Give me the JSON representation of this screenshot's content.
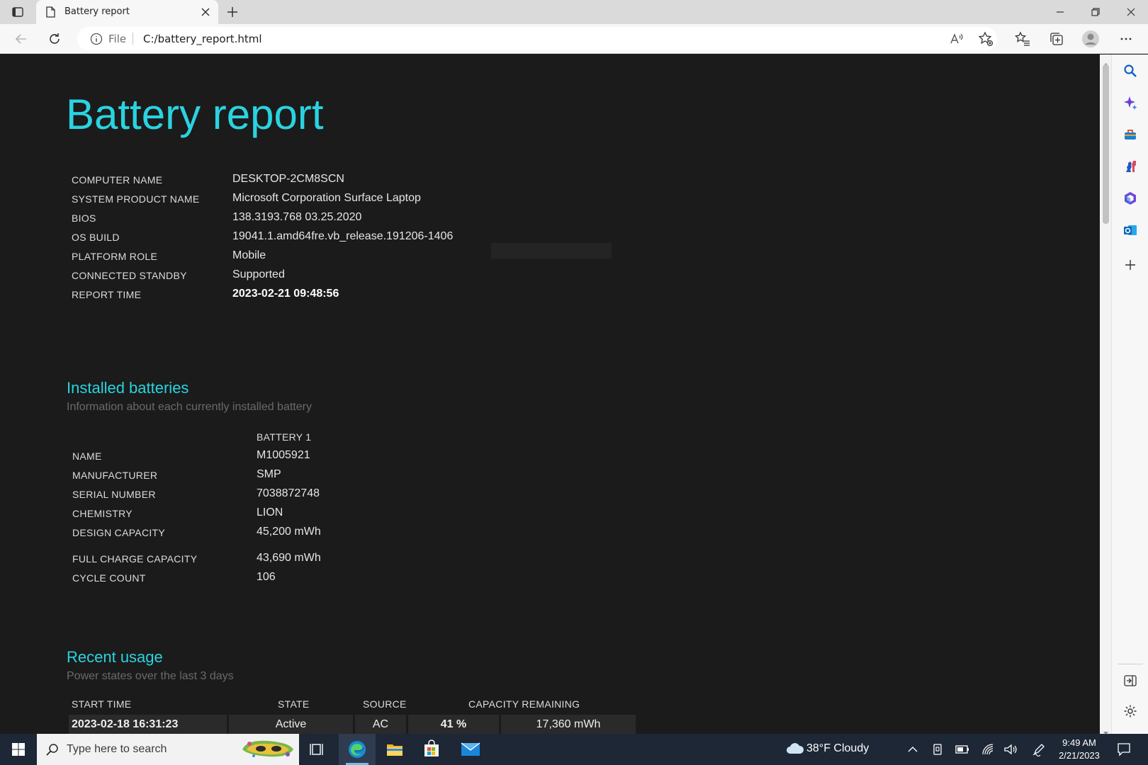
{
  "browser": {
    "tab_title": "Battery report",
    "address_scheme": "File",
    "address_url": "C:/battery_report.html"
  },
  "report": {
    "title": "Battery report",
    "system_info": [
      {
        "label": "COMPUTER NAME",
        "value": "DESKTOP-2CM8SCN"
      },
      {
        "label": "SYSTEM PRODUCT NAME",
        "value": "Microsoft Corporation Surface Laptop"
      },
      {
        "label": "BIOS",
        "value": "138.3193.768 03.25.2020"
      },
      {
        "label": "OS BUILD",
        "value": "19041.1.amd64fre.vb_release.191206-1406"
      },
      {
        "label": "PLATFORM ROLE",
        "value": "Mobile"
      },
      {
        "label": "CONNECTED STANDBY",
        "value": "Supported"
      },
      {
        "label": "REPORT TIME",
        "value": "2023-02-21  09:48:56"
      }
    ],
    "installed_batteries": {
      "heading": "Installed batteries",
      "subheading": "Information about each currently installed battery",
      "column_header": "BATTERY 1",
      "rows": [
        {
          "label": "NAME",
          "value": "M1005921"
        },
        {
          "label": "MANUFACTURER",
          "value": "SMP"
        },
        {
          "label": "SERIAL NUMBER",
          "value": "7038872748"
        },
        {
          "label": "CHEMISTRY",
          "value": "LION"
        },
        {
          "label": "DESIGN CAPACITY",
          "value": "45,200 mWh"
        },
        {
          "label": "FULL CHARGE CAPACITY",
          "value": "43,690 mWh"
        },
        {
          "label": "CYCLE COUNT",
          "value": "106"
        }
      ]
    },
    "recent_usage": {
      "heading": "Recent usage",
      "subheading": "Power states over the last 3 days",
      "columns": [
        "START TIME",
        "STATE",
        "SOURCE",
        "CAPACITY REMAINING"
      ],
      "rows": [
        {
          "start_time": "2023-02-18  16:31:23",
          "state": "Active",
          "source": "AC",
          "percent": "41 %",
          "mwh": "17,360 mWh"
        }
      ]
    }
  },
  "taskbar": {
    "search_placeholder": "Type here to search",
    "weather": "38°F  Cloudy",
    "time": "9:49 AM",
    "date": "2/21/2023"
  },
  "colors": {
    "accent": "#2ad3e0",
    "page_bg": "#1b1b1b",
    "taskbar_bg": "#1d2735"
  }
}
